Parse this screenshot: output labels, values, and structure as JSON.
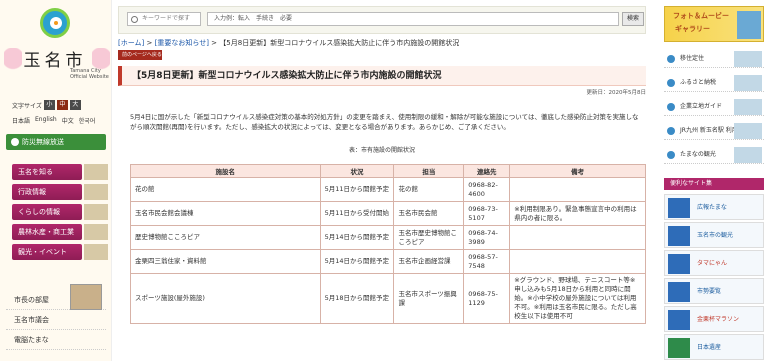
{
  "site": {
    "name": "玉名市",
    "name_en": "Tamana City Official Website"
  },
  "left": {
    "font_size_label": "文字サイズ",
    "font_size_buttons": [
      "小",
      "中",
      "大"
    ],
    "languages": [
      "日本語",
      "English",
      "中文",
      "한국어"
    ],
    "disaster_label": "防災無線放送",
    "nav": [
      "玉名を知る",
      "行政情報",
      "くらしの情報",
      "農林水産・商工業",
      "観光・イベント"
    ],
    "bottom_links": [
      "市長の部屋",
      "玉名市議会",
      "電脳たまな"
    ]
  },
  "header": {
    "search_placeholder": "キーワードで探す",
    "search_value": "入力例：転入　手続き　必要",
    "search_button": "検索"
  },
  "breadcrumb": {
    "home": "[ホーム]",
    "important": "[重要なお知らせ]",
    "sep": ">",
    "current": "【5月8日更新】新型コロナウイルス感染拡大防止に伴う市内施設の開館状況"
  },
  "back_button": "前のページへ戻る",
  "title": "【5月8日更新】新型コロナウイルス感染拡大防止に伴う市内施設の開館状況",
  "updated": "更新日：2020年5月8日",
  "body_text": "5月4日に国が示した「新型コロナウイルス感染症対策の基本的対処方針」の変更を踏まえ、使用制限の緩和・解除が可能な施設については、徹底した感染防止対策を実施しながら順次開館(再開)を行います。ただし、感染拡大の状況によっては、変更となる場合があります。あらかじめ、ご了承ください。",
  "table_caption": "表：市有施設の開館状況",
  "table": {
    "headers": [
      "施設名",
      "状況",
      "担当",
      "連絡先",
      "備考"
    ],
    "rows": [
      [
        "花の館",
        "5月11日から開館予定",
        "花の館",
        "0968-82-4600",
        ""
      ],
      [
        "玉名市民会館会議棟",
        "5月11日から受付開始",
        "玉名市民会館",
        "0968-73-5107",
        "※利用制限あり。緊急事態宣言中の利用は県内の者に限る。"
      ],
      [
        "歴史博物館こころピア",
        "5月14日から開館予定",
        "玉名市歴史博物館こころピア",
        "0968-74-3989",
        ""
      ],
      [
        "金栗四三翁住家・資料館",
        "5月14日から開館予定",
        "玉名市企画経営課",
        "0968-57-7548",
        ""
      ],
      [
        "スポーツ施設(屋外施設)",
        "5月18日から開館予定",
        "玉名市スポーツ振興課",
        "0968-75-1129",
        "※グラウンド、野球場、テニスコート等※申し込みも5月18日から利用と同時に開始。※小中学校の屋外施設については利用不可。※利用は玉名市民に限る。ただし高校生以下は使用不可"
      ]
    ]
  },
  "right": {
    "banner_line1": "フォト＆ムービー",
    "banner_line2": "ギャラリー",
    "items": [
      "移住定住",
      "ふるさと納税",
      "企業立地ガイド",
      "JR九州 新玉名駅 利用案内",
      "たまなの観光"
    ],
    "section_head": "便利なサイト集",
    "ads": [
      "広報たまな",
      "玉名市の観光",
      "タマにゃん",
      "市勢要覧",
      "金栗杯マラソン",
      "日本遺産"
    ]
  },
  "colors": {
    "accent": "#c0392b",
    "nav_magenta": "#b0276a",
    "nav_green": "#3b8f3a",
    "link": "#1a56a8"
  }
}
